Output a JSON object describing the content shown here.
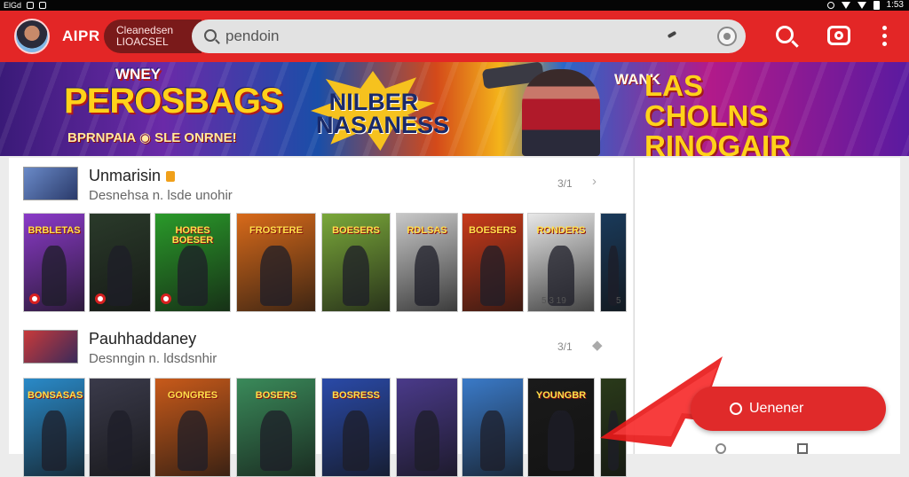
{
  "app": {
    "name": "AIPR",
    "account_label": "Cleanedsen\nLIOACSEL"
  },
  "search": {
    "placeholder": "pendoin"
  },
  "colors": {
    "brand": "#e32626",
    "banner_accent": "#ffd21a"
  },
  "banner": {
    "left_pre": "WNEY",
    "left_title": "PEROSBAGS",
    "left_sub": "BPRNPAIA ◉ SLE ONRNE!",
    "center_title": "NILBER NASANESS",
    "right_pre": "WANK",
    "right_title": "LAS CHOLNS RINOGAIR"
  },
  "sections": [
    {
      "title": "Unmarisin",
      "subtitle": "Desnehsa n. lsde unohir",
      "count": "3/1",
      "tiles": [
        {
          "label": "BRBLETAS",
          "bg": "#8a3ac8"
        },
        {
          "label": "",
          "bg": "#2a3a2a"
        },
        {
          "label": "HORES BOESER",
          "bg": "#2a9a2a"
        },
        {
          "label": "FROSTERE",
          "bg": "#d86a1a"
        },
        {
          "label": "BOESERS",
          "bg": "#7aa83a"
        },
        {
          "label": "RDLSAS",
          "bg": "#c8c8c8"
        },
        {
          "label": "BOESERS",
          "bg": "#c83a1a"
        },
        {
          "label": "RONDERS",
          "bg": "#e8e8e8"
        },
        {
          "label": "",
          "bg": "#1a3a5a"
        }
      ],
      "meta": [
        "5 3 19",
        "5"
      ]
    },
    {
      "title": "Pauhhaddaney",
      "subtitle": "Desnngin n. ldsdsnhir",
      "count": "3/1",
      "tiles": [
        {
          "label": "BONSASAS",
          "bg": "#2a8ac8"
        },
        {
          "label": "",
          "bg": "#3a3a4a"
        },
        {
          "label": "GONGRES",
          "bg": "#c85a1a"
        },
        {
          "label": "BOSERS",
          "bg": "#3a8a5a"
        },
        {
          "label": "BOSRESS",
          "bg": "#2a4aa8"
        },
        {
          "label": "",
          "bg": "#4a3a8a"
        },
        {
          "label": "",
          "bg": "#3a7ac8"
        },
        {
          "label": "YOUNGBR",
          "bg": "#1a1a1a"
        },
        {
          "label": "",
          "bg": "#2a3a1a"
        }
      ]
    }
  ],
  "float_button": {
    "label": "Uenener"
  },
  "status": {
    "time": "1:53"
  }
}
